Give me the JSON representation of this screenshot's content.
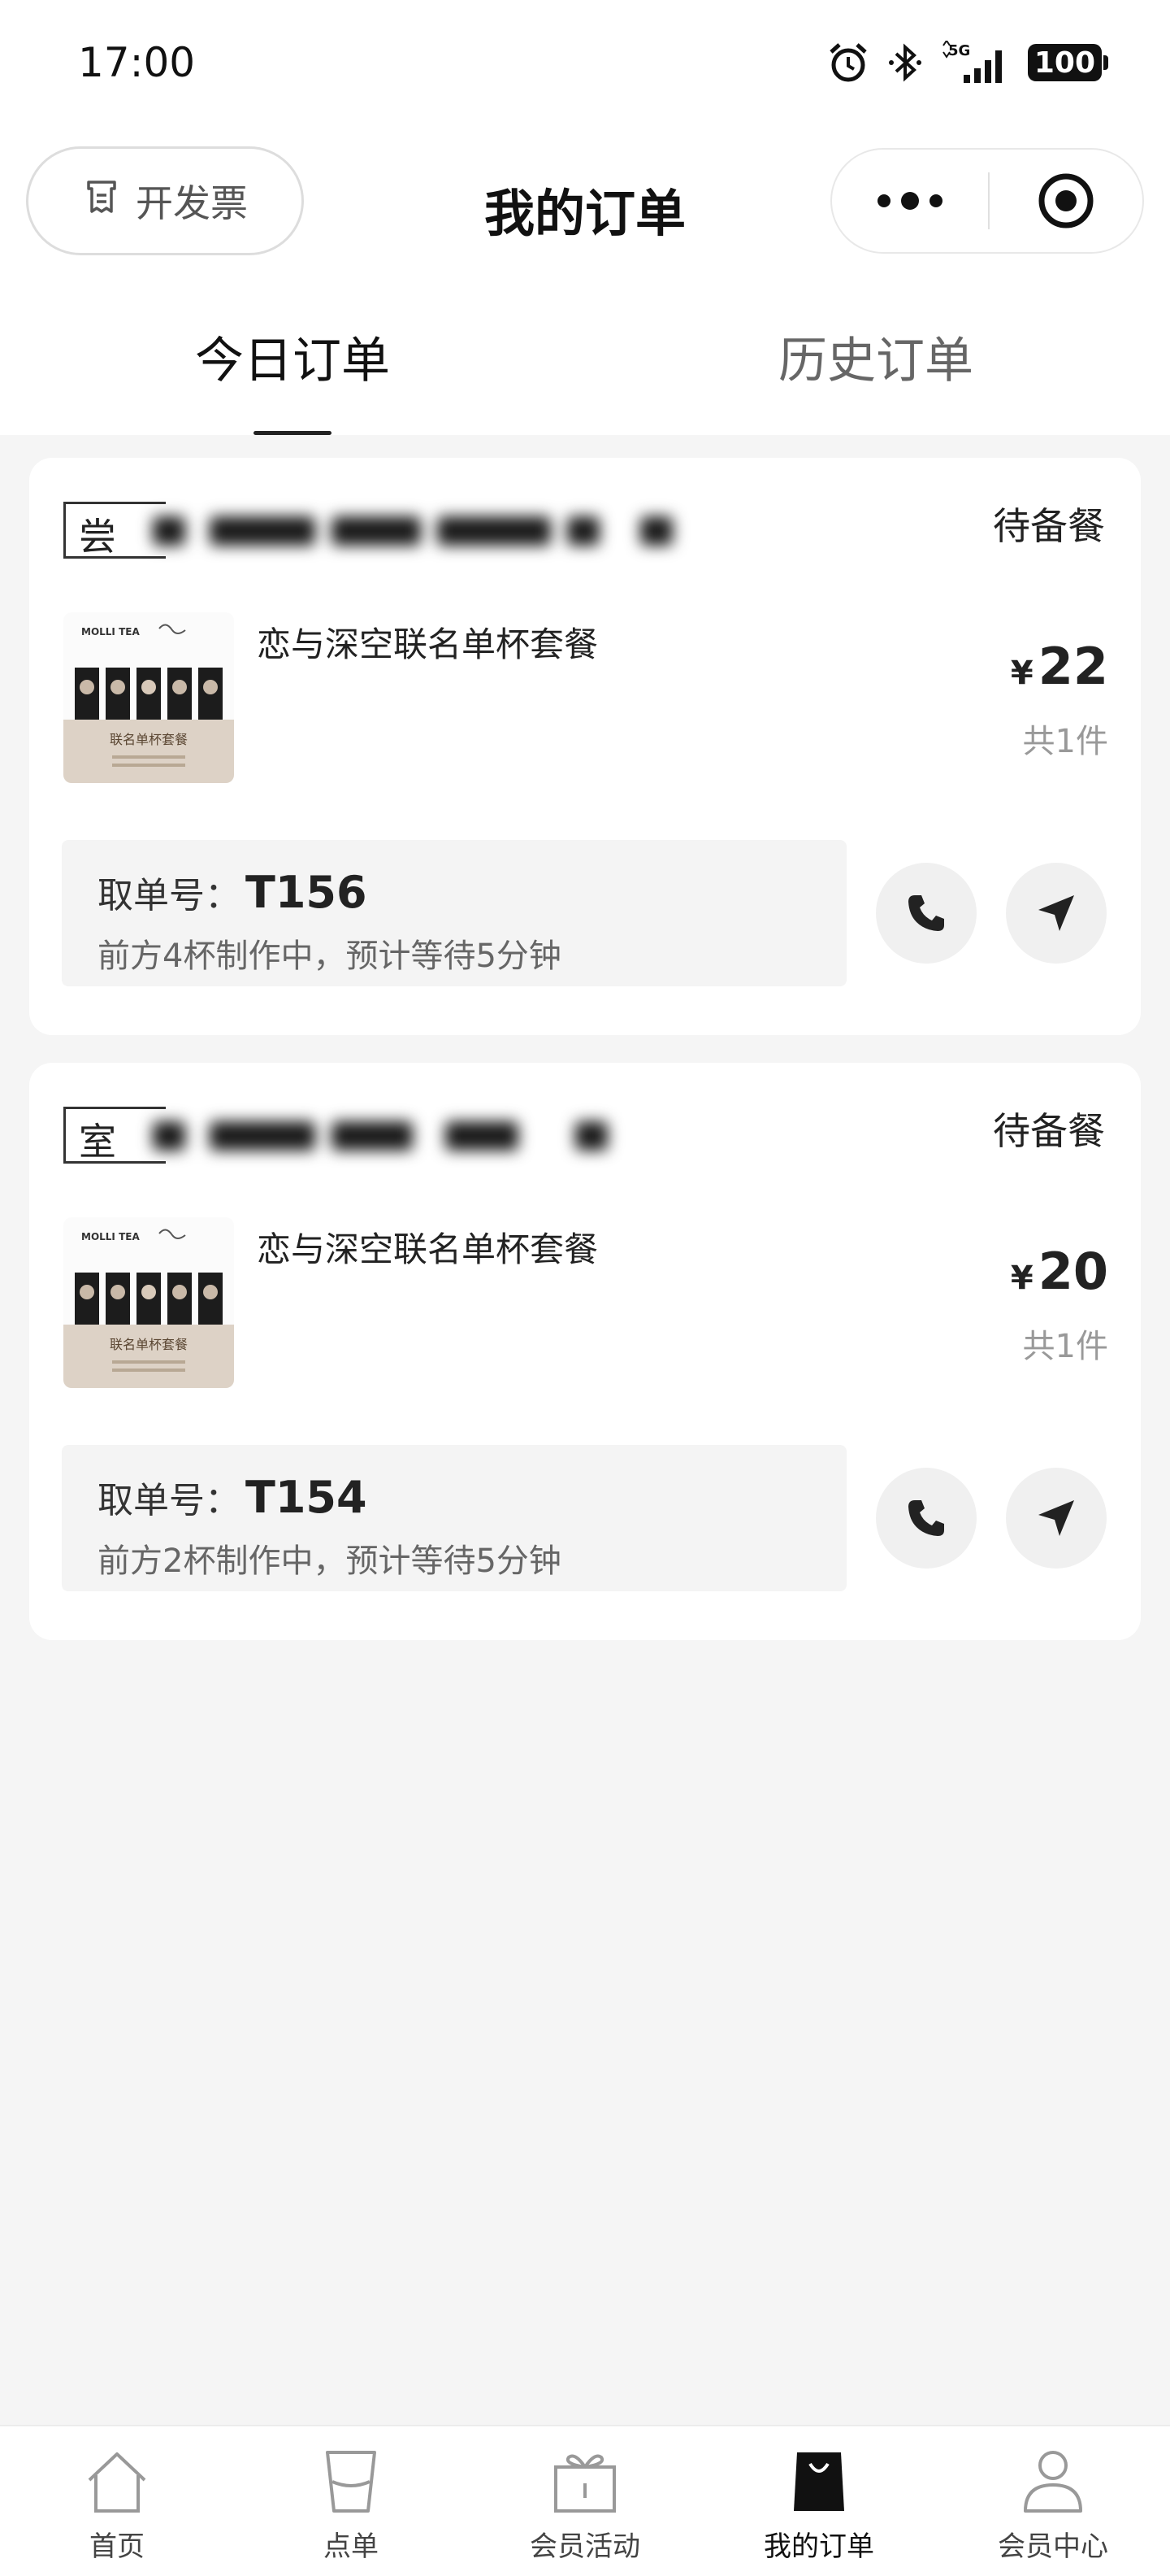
{
  "status_bar": {
    "time": "17:00",
    "network": "5G",
    "battery": "100"
  },
  "header": {
    "invoice_label": "开发票",
    "title": "我的订单"
  },
  "tabs": [
    {
      "label": "今日订单",
      "active": true
    },
    {
      "label": "历史订单",
      "active": false
    }
  ],
  "orders": [
    {
      "store_initial": "尝",
      "status": "待备餐",
      "product_name": "恋与深空联名单杯套餐",
      "currency": "¥",
      "price": "22",
      "quantity": "共1件",
      "pickup_label": "取单号：",
      "pickup_number": "T156",
      "queue_text": "前方4杯制作中，预计等待5分钟",
      "image": {
        "brand": "MOLLI TEA",
        "caption": "联名单杯套餐"
      }
    },
    {
      "store_initial": "室",
      "status": "待备餐",
      "product_name": "恋与深空联名单杯套餐",
      "currency": "¥",
      "price": "20",
      "quantity": "共1件",
      "pickup_label": "取单号：",
      "pickup_number": "T154",
      "queue_text": "前方2杯制作中，预计等待5分钟",
      "image": {
        "brand": "MOLLI TEA",
        "caption": "联名单杯套餐"
      }
    }
  ],
  "tabbar": [
    {
      "label": "首页",
      "icon": "home-icon",
      "active": false
    },
    {
      "label": "点单",
      "icon": "cup-icon",
      "active": false
    },
    {
      "label": "会员活动",
      "icon": "gift-icon",
      "active": false
    },
    {
      "label": "我的订单",
      "icon": "shopping-bag-icon",
      "active": true
    },
    {
      "label": "会员中心",
      "icon": "user-icon",
      "active": false
    }
  ],
  "colors": {
    "accent": "#222222",
    "background": "#f5f5f5",
    "card": "#ffffff",
    "muted": "#999999"
  }
}
